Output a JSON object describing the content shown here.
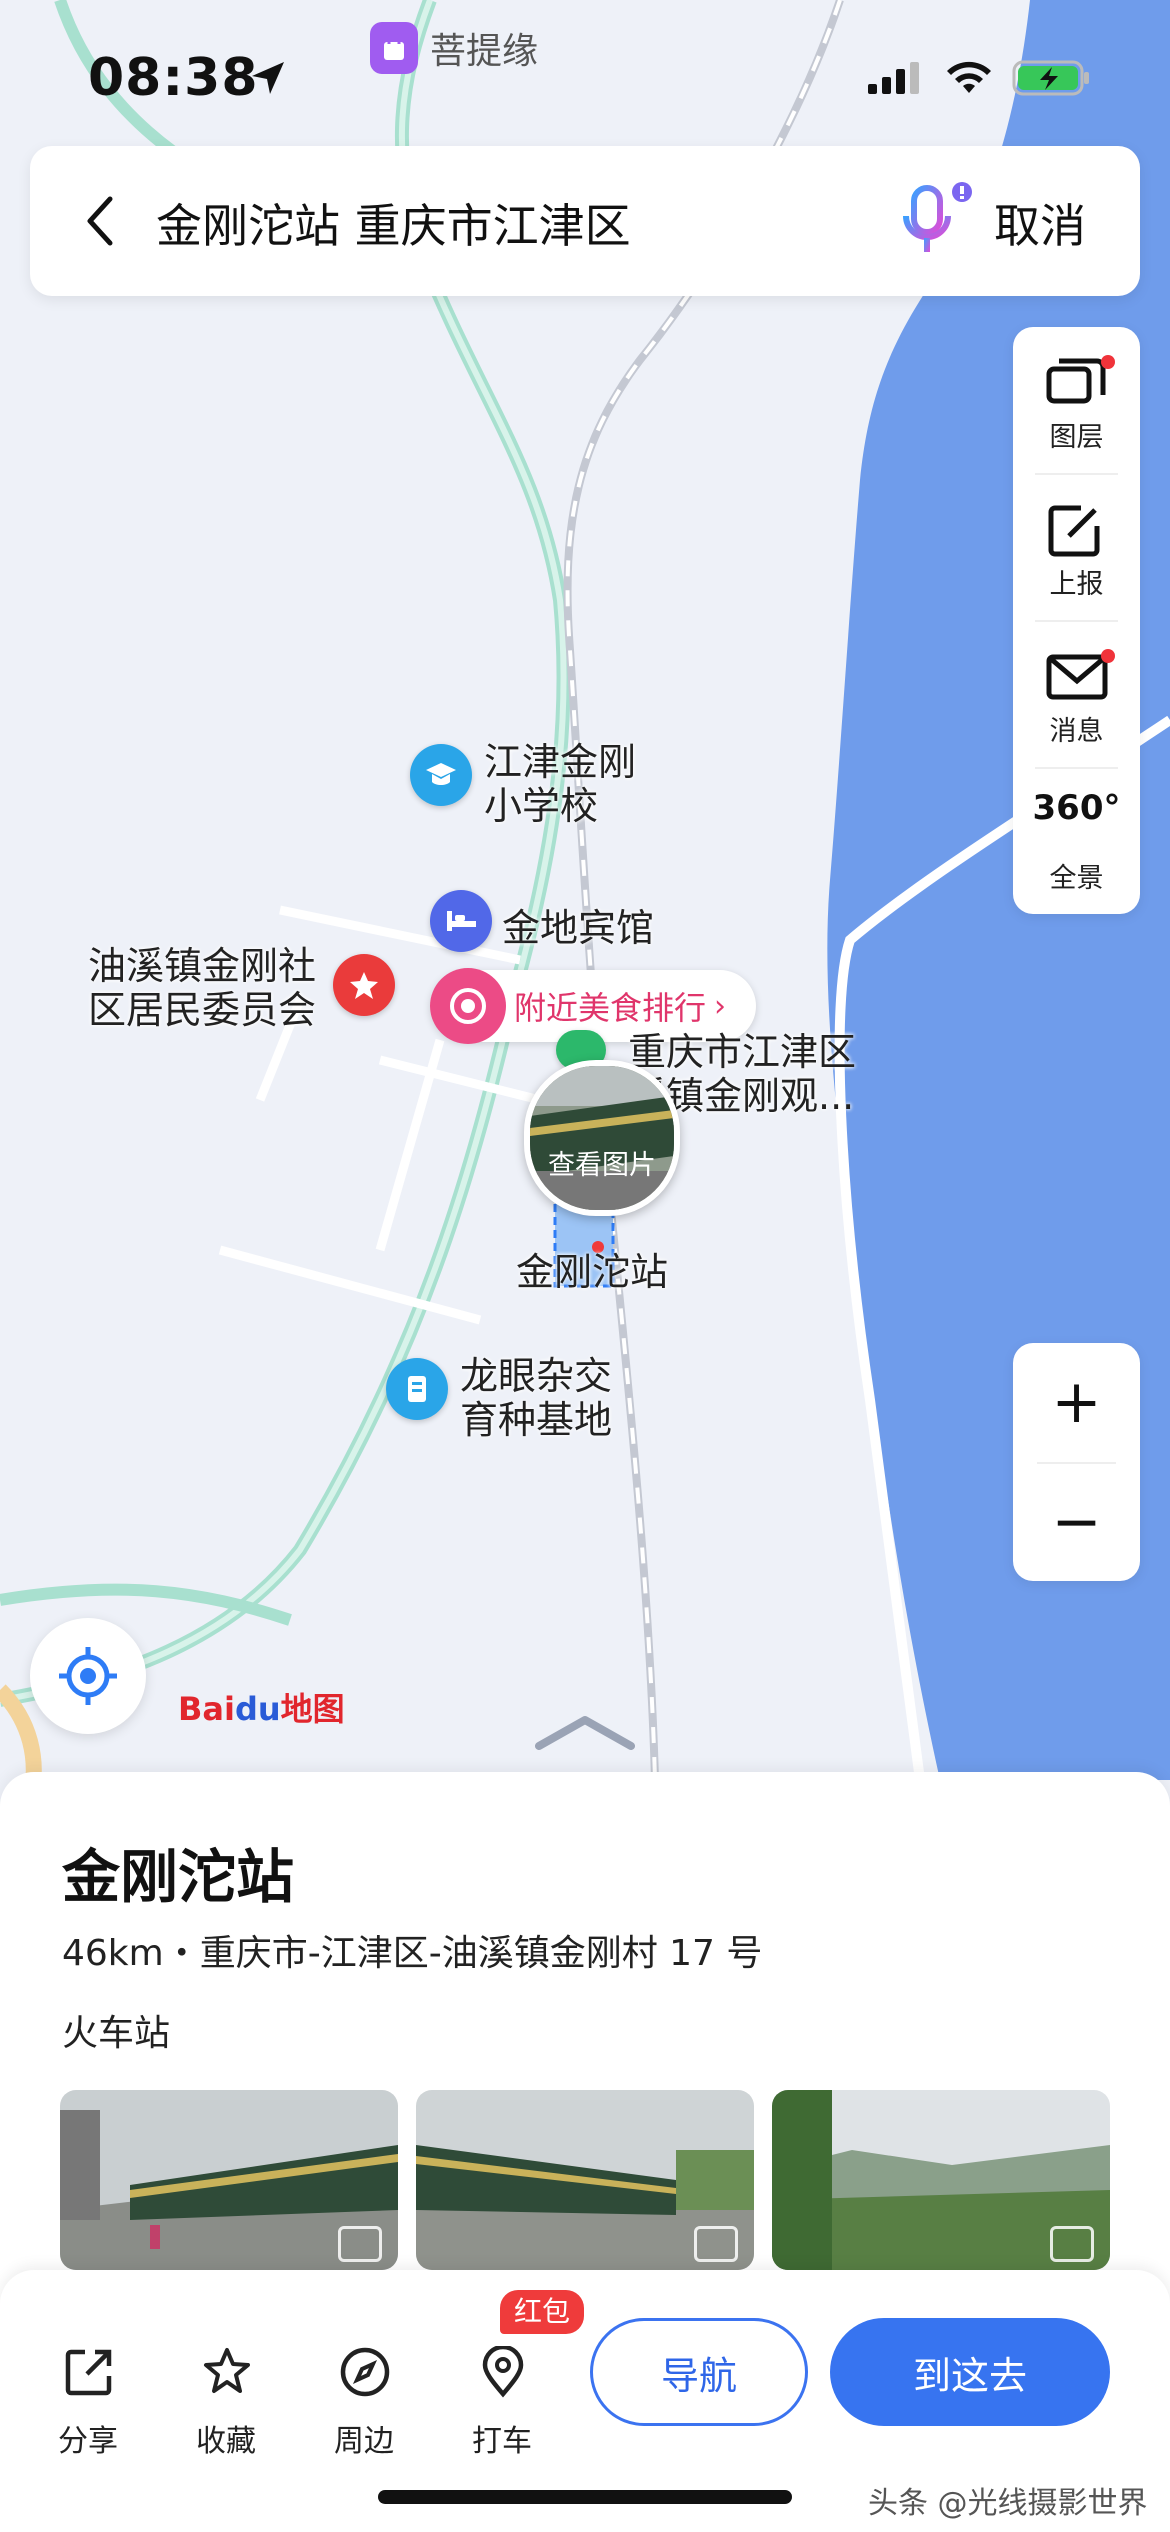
{
  "status_bar": {
    "time": "08:38"
  },
  "map": {
    "top_poi": "菩提缘",
    "pois": {
      "school_line1": "江津金刚",
      "school_line2": "小学校",
      "hotel": "金地宾馆",
      "committee_line1": "油溪镇金刚社",
      "committee_line2": "区居民委员会",
      "food_rank": "附近美食排行",
      "scenic_line1": "重庆市江津区",
      "scenic_line2": "溪镇金刚观...",
      "photo_caption": "查看图片",
      "station": "金刚沱站",
      "base_line1": "龙眼杂交",
      "base_line2": "育种基地"
    },
    "logo_bai": "Bai",
    "logo_du": "du",
    "logo_map": "地图"
  },
  "search": {
    "query": "金刚沱站 重庆市江津区",
    "cancel": "取消"
  },
  "tools": {
    "layers": "图层",
    "report": "上报",
    "messages": "消息",
    "panorama": "全景",
    "panorama_icon_text": "360°"
  },
  "zoom": {
    "plus": "+",
    "minus": "−"
  },
  "place": {
    "title": "金刚沱站",
    "address": "46km・重庆市-江津区-油溪镇金刚村 17 号",
    "category": "火车站"
  },
  "actions": {
    "share": "分享",
    "favorite": "收藏",
    "nearby": "周边",
    "taxi": "打车",
    "red_packet": "红包",
    "navigate": "导航",
    "go_here": "到这去"
  },
  "watermark": "头条 @光线摄影世界",
  "colors": {
    "accent": "#3774f0",
    "water": "#6f9ceb",
    "road_green": "#a8e0cf"
  },
  "icons": [
    "location-arrow-icon",
    "signal-icon",
    "wifi-icon",
    "battery-icon",
    "back-icon",
    "mic-icon",
    "layers-icon",
    "report-icon",
    "message-icon",
    "panorama-icon",
    "locate-icon",
    "share-icon",
    "star-icon",
    "compass-icon",
    "pin-icon"
  ]
}
